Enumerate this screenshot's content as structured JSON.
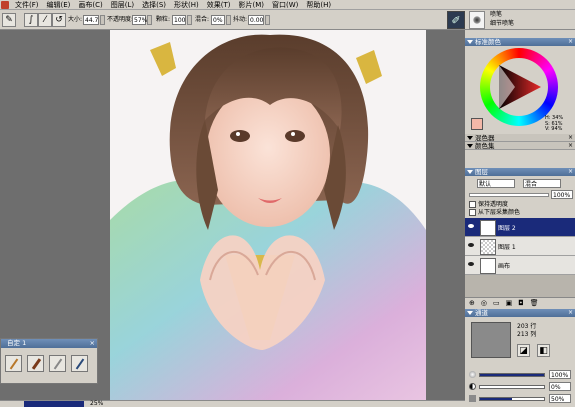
{
  "menu": {
    "items": [
      "文件(F)",
      "编辑(E)",
      "画布(C)",
      "图层(L)",
      "选择(S)",
      "形状(H)",
      "效果(T)",
      "影片(M)",
      "窗口(W)",
      "帮助(H)"
    ]
  },
  "propbar": {
    "size_label": "大小:",
    "size_value": "44.7",
    "opacity_label": "不透明度:",
    "opacity_value": "57%",
    "grain_label": "颗粒:",
    "grain_value": "100",
    "blend_label": "混合:",
    "blend_value": "0%",
    "jitter_label": "抖动:",
    "jitter_value": "0.00",
    "brush_category": "喷笔",
    "brush_variant": "细节喷笔"
  },
  "color_panel": {
    "title": "标准颜色",
    "h_readout": "H: 34%",
    "s_readout": "S: 61%",
    "v_readout": "V: 94%",
    "mixer_tab": "混色器",
    "color_set_tab": "颜色集",
    "accent_hex": "#f3b8a8"
  },
  "layers_panel": {
    "title": "图层",
    "composite_method": "默认",
    "composite_depth": "混合",
    "opacity_value": "100%",
    "preserve_transparency": "保持透明度",
    "pick_up_underlying": "从下层采集颜色",
    "layers": [
      {
        "name": "图层 2",
        "selected": true
      },
      {
        "name": "图层 1",
        "selected": false
      },
      {
        "name": "画布",
        "selected": false
      }
    ]
  },
  "channels_panel": {
    "title": "通道",
    "rows_text": "203 行",
    "cols_text": "213 列",
    "opacity_1": "100%",
    "opacity_2": "0%",
    "opacity_3": "50%"
  },
  "custom_palette": {
    "title": "自定 1"
  },
  "status": {
    "zoom": "25%"
  }
}
